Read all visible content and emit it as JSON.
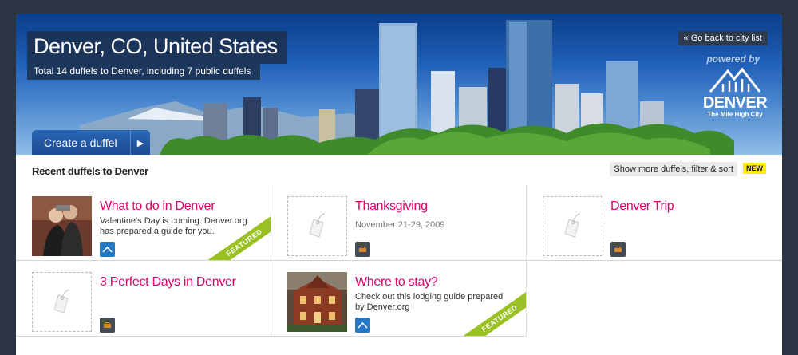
{
  "hero": {
    "title": "Denver, CO, United States",
    "subtitle": "Total 14 duffels to Denver, including 7 public duffels",
    "create_button": "Create a duffel",
    "back_link": "« Go back to city list",
    "powered_by": "powered by",
    "logo_brand": "DENVER",
    "logo_tag": "The Mile High City"
  },
  "section": {
    "title": "Recent duffels to Denver",
    "show_more": "Show more duffels, filter & sort",
    "new_badge": "NEW"
  },
  "cards": [
    {
      "title": "What to do in Denver",
      "desc": "Valentine's Day is coming. Denver.org has prepared a guide for you.",
      "featured": "FEATURED"
    },
    {
      "title": "Thanksgiving",
      "date": "November 21-29, 2009"
    },
    {
      "title": "Denver Trip"
    },
    {
      "title": "3 Perfect Days in Denver"
    },
    {
      "title": "Where to stay?",
      "desc": "Check out this lodging guide prepared by Denver.org",
      "featured": "FEATURED"
    }
  ],
  "colors": {
    "accent": "#e0006c",
    "featured": "#9ac122",
    "header_bg": "#2a3442",
    "new": "#ffed00"
  }
}
